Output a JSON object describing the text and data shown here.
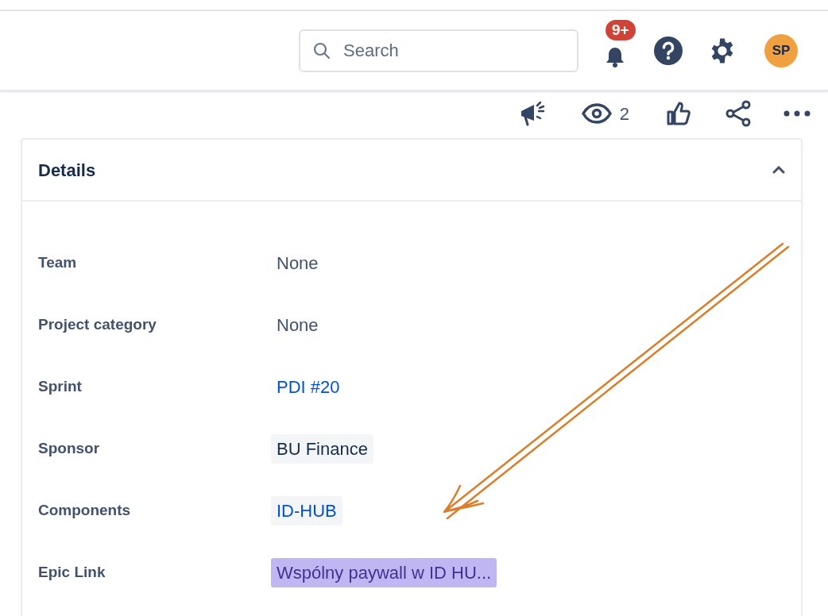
{
  "top_bar": {
    "search": {
      "placeholder": "Search"
    },
    "notifications_badge": "9+",
    "avatar": "SP"
  },
  "issue_actions": {
    "watchers": "2"
  },
  "details": {
    "title": "Details",
    "expanded": true,
    "fields": [
      {
        "label": "Team",
        "value": "None",
        "kind": "plain"
      },
      {
        "label": "Project category",
        "value": "None",
        "kind": "plain"
      },
      {
        "label": "Sprint",
        "value": "PDI #20",
        "kind": "link"
      },
      {
        "label": "Sponsor",
        "value": "BU Finance",
        "kind": "tag"
      },
      {
        "label": "Components",
        "value": "ID-HUB",
        "kind": "link-tag"
      },
      {
        "label": "Epic Link",
        "value": "Wspólny paywall w ID HU...",
        "kind": "epic"
      }
    ]
  }
}
